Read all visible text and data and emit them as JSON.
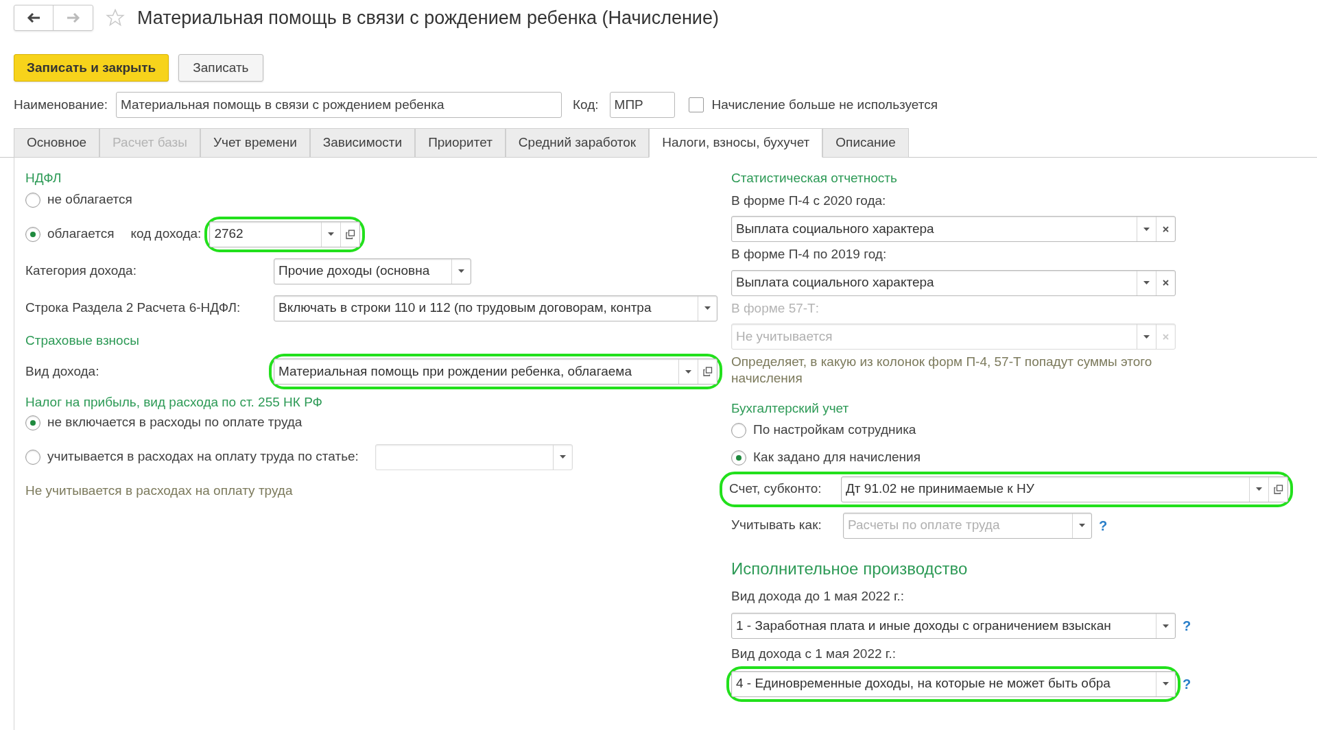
{
  "window": {
    "title": "Материальная помощь в связи с рождением ребенка (Начисление)"
  },
  "toolbar": [
    {
      "label": "Записать и закрыть",
      "kind": "primary"
    },
    {
      "label": "Записать",
      "kind": "default"
    }
  ],
  "name_row": {
    "label": "Наименование:",
    "value": "Материальная помощь в связи с рождением ребенка",
    "code_label": "Код:",
    "code_value": "МПР",
    "unused": {
      "label": "Начисление больше не используется",
      "checked": false
    }
  },
  "tabs": [
    {
      "label": "Основное",
      "selected": false,
      "disabled": false
    },
    {
      "label": "Расчет базы",
      "selected": false,
      "disabled": true
    },
    {
      "label": "Учет времени",
      "selected": false,
      "disabled": false
    },
    {
      "label": "Зависимости",
      "selected": false,
      "disabled": false
    },
    {
      "label": "Приоритет",
      "selected": false,
      "disabled": false
    },
    {
      "label": "Средний заработок",
      "selected": false,
      "disabled": false
    },
    {
      "label": "Налоги, взносы, бухучет",
      "selected": true,
      "disabled": false
    },
    {
      "label": "Описание",
      "selected": false,
      "disabled": false
    }
  ],
  "ndfl": {
    "heading": "НДФЛ",
    "options": [
      {
        "label": "не облагается",
        "selected": false
      },
      {
        "label": "облагается",
        "selected": true
      }
    ],
    "income_code": {
      "label": "код дохода:",
      "value": "2762",
      "kind": "reference",
      "highlighted": true
    },
    "category": {
      "label": "Категория дохода:",
      "value": "Прочие доходы (основна",
      "kind": "choice"
    },
    "report_line": {
      "label": "Строка Раздела 2 Расчета 6-НДФЛ:",
      "value": "Включать в строки 110 и 112 (по трудовым договорам, контра",
      "kind": "choice"
    }
  },
  "insurance": {
    "heading": "Страховые взносы",
    "income_type": {
      "label": "Вид дохода:",
      "value": "Материальная помощь при рождении ребенка, облагаема",
      "kind": "reference",
      "highlighted": true
    }
  },
  "profit_tax": {
    "heading": "Налог на прибыль, вид расхода по ст. 255 НК РФ",
    "options": [
      {
        "label": "не включается в расходы по оплате труда",
        "selected": true
      },
      {
        "label": "учитывается в расходах на оплату труда по статье:",
        "selected": false
      }
    ],
    "note": "Не учитывается в расходах на оплату труда"
  },
  "statistics": {
    "heading": "Статистическая отчетность",
    "fields": [
      {
        "label": "В форме П-4 с 2020 года:",
        "value": "Выплата социального характера",
        "disabled": false
      },
      {
        "label": "В форме П-4 по 2019 год:",
        "value": "Выплата социального характера",
        "disabled": false
      },
      {
        "label": "В форме 57-Т:",
        "value": "Не учитывается",
        "disabled": true
      }
    ],
    "note": "Определяет, в какую из колонок форм П-4, 57-Т попадут суммы этого начисления"
  },
  "accounting": {
    "heading": "Бухгалтерский учет",
    "options": [
      {
        "label": "По настройкам сотрудника",
        "selected": false
      },
      {
        "label": "Как задано для начисления",
        "selected": true
      }
    ],
    "account": {
      "label": "Счет, субконто:",
      "value": "Дт 91.02 не принимаемые к НУ",
      "kind": "reference",
      "highlighted": true
    },
    "account_as": {
      "label": "Учитывать как:",
      "placeholder": "Расчеты по оплате труда",
      "help": "?"
    }
  },
  "enforcement": {
    "heading": "Исполнительное производство",
    "fields": [
      {
        "label": "Вид дохода до 1 мая 2022 г.:",
        "value": "1 - Заработная плата и иные доходы с ограничением взыскан",
        "help": "?"
      },
      {
        "label": "Вид дохода с 1 мая 2022 г.:",
        "value": "4 - Единовременные доходы, на которые не может быть обра",
        "help": "?",
        "highlighted": true
      }
    ]
  }
}
